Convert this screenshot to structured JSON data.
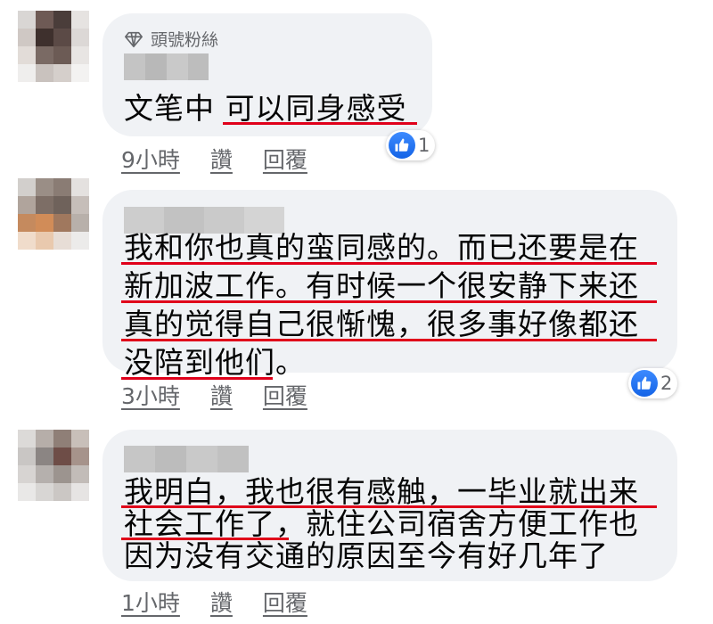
{
  "comments": [
    {
      "badge": "頭號粉絲",
      "lines": [
        "文笔中 可以同身感受"
      ],
      "time": "9小時",
      "like_label": "讚",
      "reply_label": "回覆",
      "reactions": "1"
    },
    {
      "lines": [
        "我和你也真的蛮同感的。而已还要是在",
        "新加波工作。有时候一个很安静下来还",
        "真的觉得自己很惭愧，很多事好像都还",
        "没陪到他们。"
      ],
      "time": "3小時",
      "like_label": "讚",
      "reply_label": "回覆",
      "reactions": "2"
    },
    {
      "lines": [
        "我明白，我也很有感触，一毕业就出来",
        "社会工作了，就住公司宿舍方便工作也",
        "因为没有交通的原因至今有好几年了"
      ],
      "time": "1小時",
      "like_label": "讚",
      "reply_label": "回覆"
    }
  ],
  "colors": {
    "underline": "#e0001a",
    "bubble": "#f0f2f5",
    "like_blue": "#1877f2",
    "meta_text": "#65676b"
  }
}
